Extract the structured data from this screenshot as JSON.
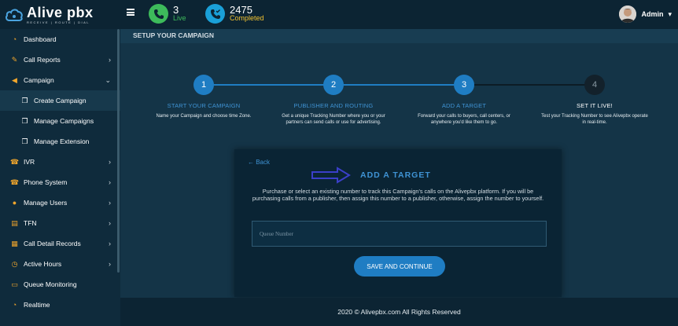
{
  "brand": {
    "name": "Alive",
    "name2": "pbx",
    "tagline": "RECEIVE | ROUTE | DIAL"
  },
  "topbar": {
    "live": {
      "value": "3",
      "label": "Live"
    },
    "completed": {
      "value": "2475",
      "label": "Completed"
    },
    "user": {
      "name": "Admin",
      "caret": "▾"
    }
  },
  "sidebar": {
    "items": [
      {
        "label": "Dashboard",
        "icon": "dashboard-icon"
      },
      {
        "label": "Call Reports",
        "icon": "call-reports-icon",
        "arrow": "›"
      },
      {
        "label": "Campaign",
        "icon": "campaign-icon",
        "arrow": "⌄"
      },
      {
        "label": "Create Campaign",
        "icon": "copy-icon"
      },
      {
        "label": "Manage Campaigns",
        "icon": "copy-icon"
      },
      {
        "label": "Manage Extension",
        "icon": "copy-icon"
      },
      {
        "label": "IVR",
        "icon": "ivr-icon",
        "arrow": "›"
      },
      {
        "label": "Phone System",
        "icon": "phone-system-icon",
        "arrow": "›"
      },
      {
        "label": "Manage Users",
        "icon": "users-icon",
        "arrow": "›"
      },
      {
        "label": "TFN",
        "icon": "tfn-icon",
        "arrow": "›"
      },
      {
        "label": "Call Detail Records",
        "icon": "records-icon",
        "arrow": "›"
      },
      {
        "label": "Active Hours",
        "icon": "clock-icon",
        "arrow": "›"
      },
      {
        "label": "Queue Monitoring",
        "icon": "monitor-icon"
      },
      {
        "label": "Realtime",
        "icon": "realtime-icon"
      }
    ]
  },
  "page": {
    "title": "SETUP YOUR CAMPAIGN"
  },
  "steps": [
    {
      "number": "1",
      "title": "START YOUR CAMPAIGN",
      "desc": "Name your Campaign and choose time Zone."
    },
    {
      "number": "2",
      "title": "PUBLISHER AND ROUTING",
      "desc": "Get a unique Tracking Number where you or your partners can send calls or use for advertising."
    },
    {
      "number": "3",
      "title": "ADD A TARGET",
      "desc": "Forward your calls to buyers, call centers, or anywhere you'd like them to go."
    },
    {
      "number": "4",
      "title": "SET IT LIVE!",
      "desc": "Test your Tracking Number to see Alivepbx operate in real-time."
    }
  ],
  "card": {
    "back": "← Back",
    "title": "ADD A TARGET",
    "description": "Purchase or select an existing number to track this Campaign's calls on the Alivepbx platform. If you will be purchasing calls from a publisher, then assign this number to a publisher, otherwise, assign the number to yourself.",
    "queue_placeholder": "Queue Number",
    "save_label": "SAVE AND CONTINUE"
  },
  "footer": {
    "text": "2020 © Alivepbx.com All Rights Reserved"
  },
  "colors": {
    "accent": "#1f7dc3",
    "accent_text": "#3f93d4",
    "live": "#3dbb5b",
    "completed": "#1aa0d8",
    "completed_text": "#f2c230",
    "inactive_step": "#13212b"
  }
}
